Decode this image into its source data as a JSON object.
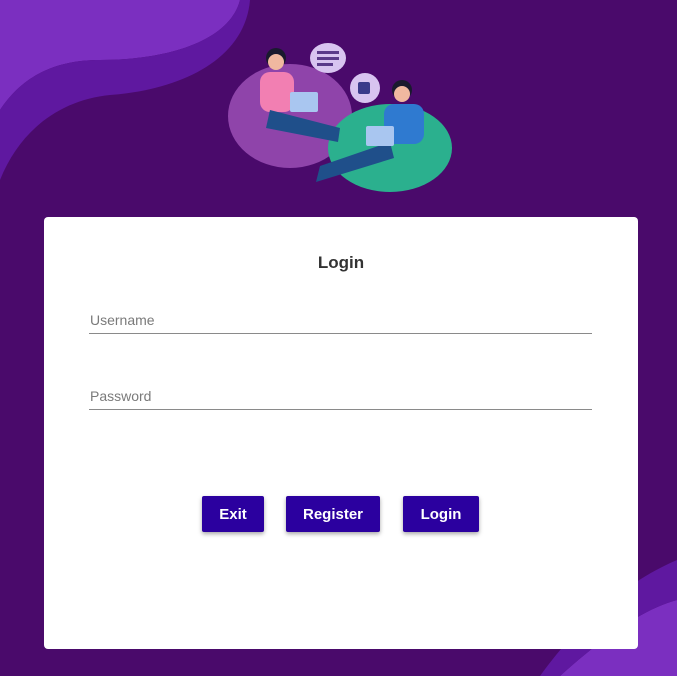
{
  "illustration": "two-people-on-beanbags-with-laptops",
  "form": {
    "title": "Login",
    "username_placeholder": "Username",
    "password_placeholder": "Password"
  },
  "buttons": {
    "exit": "Exit",
    "register": "Register",
    "login": "Login"
  },
  "colors": {
    "background": "#4a0a6b",
    "wave_light": "#7b2fc0",
    "button": "#2b009f",
    "card": "#ffffff"
  }
}
